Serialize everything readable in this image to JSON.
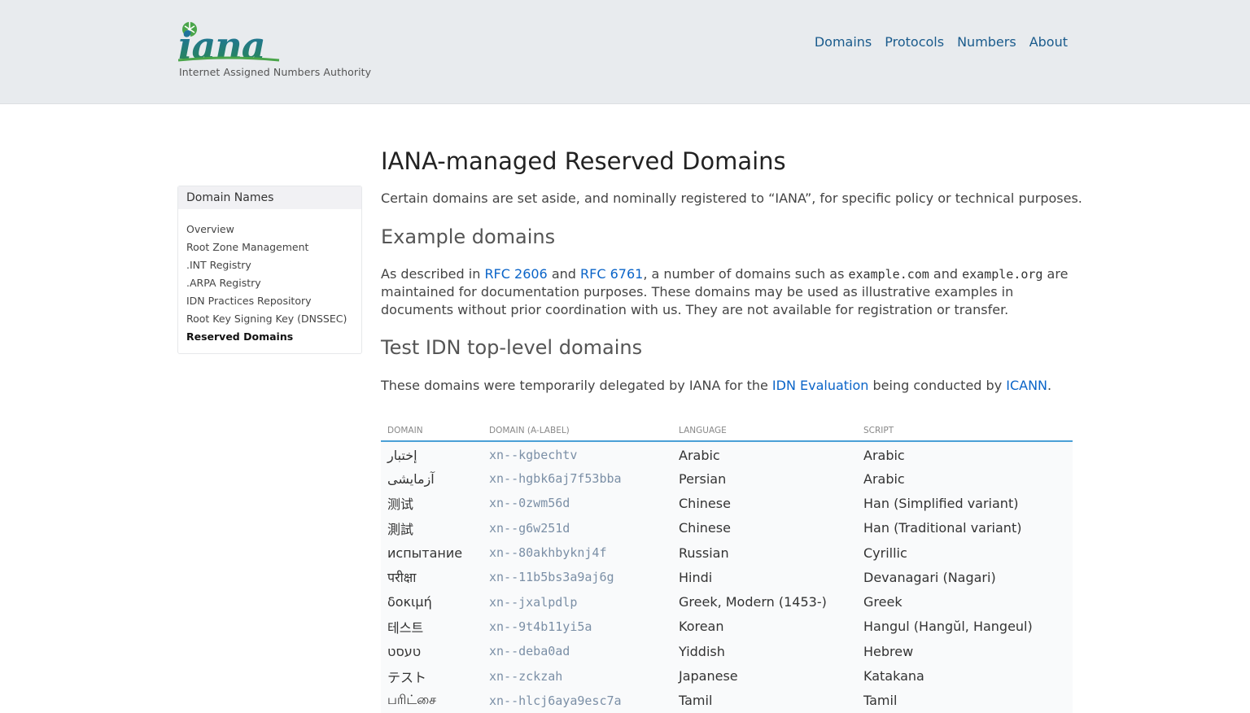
{
  "header": {
    "logo_tagline": "Internet Assigned Numbers Authority",
    "nav": [
      "Domains",
      "Protocols",
      "Numbers",
      "About"
    ]
  },
  "sidebar": {
    "title": "Domain Names",
    "items": [
      {
        "label": "Overview",
        "active": false
      },
      {
        "label": "Root Zone Management",
        "active": false
      },
      {
        "label": ".INT Registry",
        "active": false
      },
      {
        "label": ".ARPA Registry",
        "active": false
      },
      {
        "label": "IDN Practices Repository",
        "active": false
      },
      {
        "label": "Root Key Signing Key (DNSSEC)",
        "active": false
      },
      {
        "label": "Reserved Domains",
        "active": true
      }
    ]
  },
  "main": {
    "title": "IANA-managed Reserved Domains",
    "intro": "Certain domains are set aside, and nominally registered to “IANA”, for specific policy or technical purposes.",
    "example": {
      "heading": "Example domains",
      "p1": "As described in ",
      "rfc1": "RFC 2606",
      "p2": " and ",
      "rfc2": "RFC 6761",
      "p3": ", a number of domains such as ",
      "code1": "example.com",
      "p4": " and ",
      "code2": "example.org",
      "p5": " are maintained for documentation purposes. These domains may be used as illustrative examples in documents without prior coordination with us. They are not available for registration or transfer."
    },
    "idn": {
      "heading": "Test IDN top-level domains",
      "p1": "These domains were temporarily delegated by IANA for the ",
      "link1": "IDN Evaluation",
      "p2": " being conducted by ",
      "link2": "ICANN",
      "p3": "."
    }
  },
  "table": {
    "headers": [
      "DOMAIN",
      "DOMAIN (A-LABEL)",
      "LANGUAGE",
      "SCRIPT"
    ],
    "rows": [
      {
        "domain": "إختبار",
        "alabel": "xn--kgbechtv",
        "language": "Arabic",
        "script": "Arabic"
      },
      {
        "domain": "آزمایشی",
        "alabel": "xn--hgbk6aj7f53bba",
        "language": "Persian",
        "script": "Arabic"
      },
      {
        "domain": "测试",
        "alabel": "xn--0zwm56d",
        "language": "Chinese",
        "script": "Han (Simplified variant)"
      },
      {
        "domain": "測試",
        "alabel": "xn--g6w251d",
        "language": "Chinese",
        "script": "Han (Traditional variant)"
      },
      {
        "domain": "испытание",
        "alabel": "xn--80akhbyknj4f",
        "language": "Russian",
        "script": "Cyrillic"
      },
      {
        "domain": "परीक्षा",
        "alabel": "xn--11b5bs3a9aj6g",
        "language": "Hindi",
        "script": "Devanagari (Nagari)"
      },
      {
        "domain": "δοκιμή",
        "alabel": "xn--jxalpdlp",
        "language": "Greek, Modern (1453-)",
        "script": "Greek"
      },
      {
        "domain": "테스트",
        "alabel": "xn--9t4b11yi5a",
        "language": "Korean",
        "script": "Hangul (Hangŭl, Hangeul)"
      },
      {
        "domain": "טעסט",
        "alabel": "xn--deba0ad",
        "language": "Yiddish",
        "script": "Hebrew"
      },
      {
        "domain": "テスト",
        "alabel": "xn--zckzah",
        "language": "Japanese",
        "script": "Katakana"
      },
      {
        "domain": "பரிட்சை",
        "alabel": "xn--hlcj6aya9esc7a",
        "language": "Tamil",
        "script": "Tamil"
      }
    ]
  },
  "colors": {
    "header_bg": "#e8ebee",
    "nav_link": "#1a5b8c",
    "link": "#0a64c8",
    "logo_green": "#4aa54a",
    "logo_blue": "#1c6db5",
    "table_rule": "#4a9fd6"
  }
}
